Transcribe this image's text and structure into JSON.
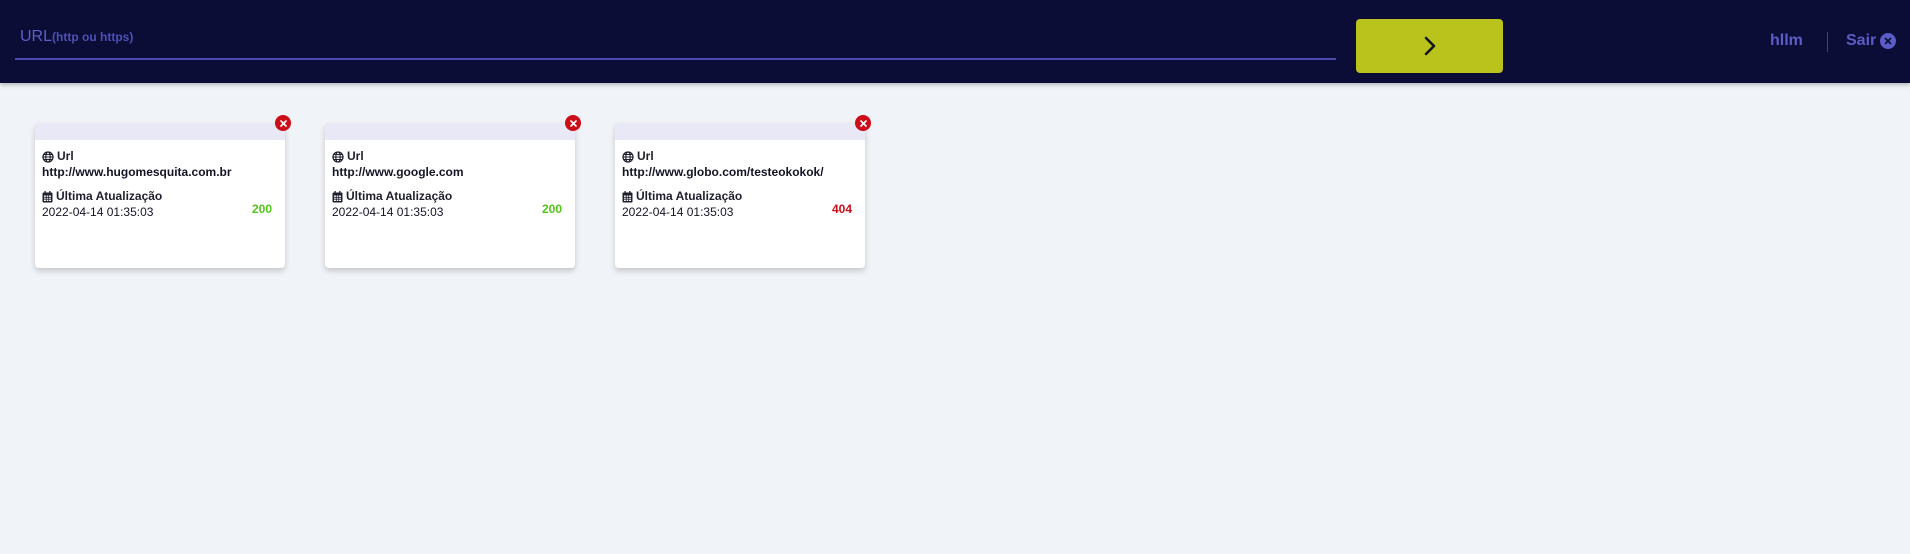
{
  "header": {
    "url_label": "URL",
    "url_hint": "(http ou https)",
    "url_value": "",
    "submit_icon": "chevron-right-icon",
    "user_name": "hllm",
    "logout_label": "Sair",
    "logout_icon": "close-circle-icon"
  },
  "colors": {
    "header_bg": "#0b0d36",
    "accent_button": "#b9c31c",
    "status_ok": "#52c41a",
    "status_error": "#cc0d1a",
    "remove_button": "#cc0d1a"
  },
  "cards": [
    {
      "url_title": "Url",
      "url": "http://www.hugomesquita.com.br",
      "updated_title": "Última Atualização",
      "updated": "2022-04-14 01:35:03",
      "status": "200"
    },
    {
      "url_title": "Url",
      "url": "http://www.google.com",
      "updated_title": "Última Atualização",
      "updated": "2022-04-14 01:35:03",
      "status": "200"
    },
    {
      "url_title": "Url",
      "url": "http://www.globo.com/testeokokok/",
      "updated_title": "Última Atualização",
      "updated": "2022-04-14 01:35:03",
      "status": "404"
    }
  ]
}
